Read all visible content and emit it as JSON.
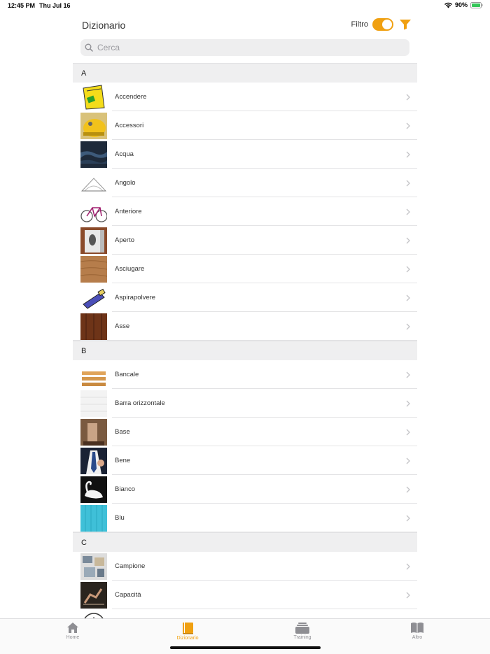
{
  "status": {
    "time": "12:45 PM",
    "date": "Thu Jul 16",
    "battery": "90%"
  },
  "header": {
    "title": "Dizionario",
    "filter_label": "Filtro",
    "filter_on": true
  },
  "search": {
    "placeholder": "Cerca"
  },
  "colors": {
    "accent": "#f0a011",
    "section_bg": "#efeff0"
  },
  "sections": [
    {
      "letter": "A",
      "items": [
        {
          "label": "Accendere",
          "icon": "yellow-switch-thumb"
        },
        {
          "label": "Accessori",
          "icon": "helmet-thumb"
        },
        {
          "label": "Acqua",
          "icon": "water-thumb"
        },
        {
          "label": "Angolo",
          "icon": "angle-thumb"
        },
        {
          "label": "Anteriore",
          "icon": "bicycle-thumb"
        },
        {
          "label": "Aperto",
          "icon": "door-thumb"
        },
        {
          "label": "Asciugare",
          "icon": "wood-thumb"
        },
        {
          "label": "Aspirapolvere",
          "icon": "vacuum-thumb"
        },
        {
          "label": "Asse",
          "icon": "plank-thumb"
        }
      ]
    },
    {
      "letter": "B",
      "items": [
        {
          "label": "Bancale",
          "icon": "pallet-thumb"
        },
        {
          "label": "Barra orizzontale",
          "icon": "white-wall-thumb"
        },
        {
          "label": "Base",
          "icon": "base-thumb"
        },
        {
          "label": "Bene",
          "icon": "thumbs-up-thumb"
        },
        {
          "label": "Bianco",
          "icon": "swan-thumb"
        },
        {
          "label": "Blu",
          "icon": "blue-wood-thumb"
        }
      ]
    },
    {
      "letter": "C",
      "items": [
        {
          "label": "Campione",
          "icon": "samples-thumb"
        },
        {
          "label": "Capacità",
          "icon": "gymnast-thumb"
        },
        {
          "label": "",
          "icon": "clock-thumb"
        }
      ]
    }
  ],
  "tabs": [
    {
      "label": "Home",
      "icon": "home-icon",
      "active": false
    },
    {
      "label": "Dizionario",
      "icon": "book-icon",
      "active": true
    },
    {
      "label": "Training",
      "icon": "stack-icon",
      "active": false
    },
    {
      "label": "Altro",
      "icon": "open-book-icon",
      "active": false
    }
  ]
}
